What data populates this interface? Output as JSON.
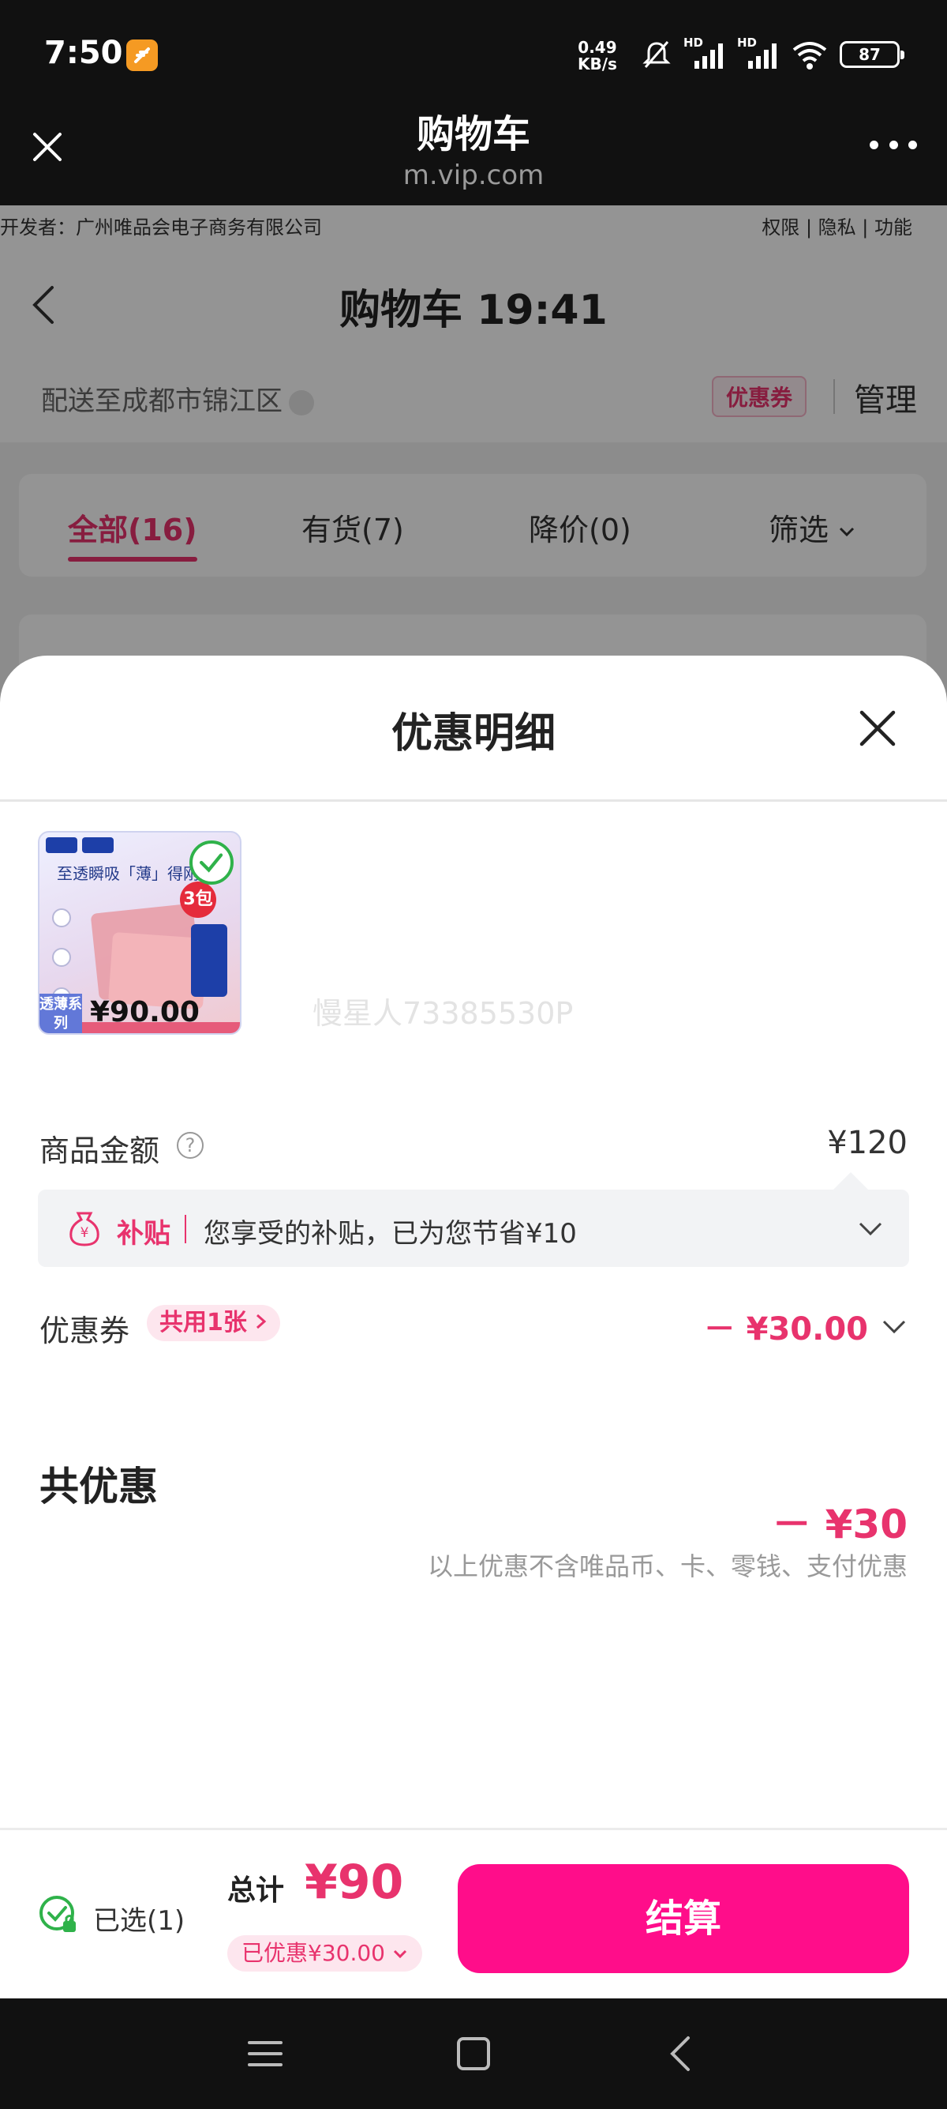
{
  "status_bar": {
    "time": "7:50",
    "app_icon": "feather-app-icon",
    "net_speed_value": "0.49",
    "net_speed_unit": "KB/s",
    "battery": "87",
    "network_1": "HD",
    "network_2": "HD",
    "icons": [
      "mute-icon",
      "signal-icon",
      "signal-icon",
      "wifi-icon",
      "battery-icon"
    ]
  },
  "browser": {
    "title": "购物车",
    "url": "m.vip.com"
  },
  "page": {
    "developer_prefix": "开发者：",
    "developer": "广州唯品会电子商务有限公司",
    "links": [
      "权限",
      "隐私",
      "功能"
    ],
    "title": "购物车 19:41",
    "location": "配送至成都市锦江区",
    "coupon_tag": "优惠券",
    "manage": "管理",
    "tabs": [
      {
        "label": "全部(16)",
        "active": true
      },
      {
        "label": "有货(7)",
        "active": false
      },
      {
        "label": "降价(0)",
        "active": false
      },
      {
        "label": "筛选",
        "active": false
      }
    ]
  },
  "sheet": {
    "title": "优惠明细",
    "product": {
      "price": "¥90.00",
      "slogan": "至透瞬吸「薄」得刚",
      "pack_badge": "3包",
      "series": "透薄系列"
    },
    "watermark": "慢星人73385530P",
    "amount": {
      "label": "商品金额",
      "value": "¥120"
    },
    "subsidy": {
      "tag": "补贴",
      "text": "您享受的补贴，已为您节省¥10"
    },
    "coupon": {
      "label": "优惠券",
      "count": "共用1张",
      "value": "－ ¥30.00"
    },
    "total": {
      "label": "共优惠",
      "value": "－ ¥30",
      "note": "以上优惠不含唯品币、卡、零钱、支付优惠"
    }
  },
  "footer": {
    "selected": "已选(1)",
    "sum_label": "总计",
    "sum_value": "¥90",
    "saved": "已优惠¥30.00",
    "checkout": "结算"
  },
  "colors": {
    "accent": "#e8336d",
    "checkout": "#ff0d8a",
    "check_green": "#2fb24a"
  }
}
